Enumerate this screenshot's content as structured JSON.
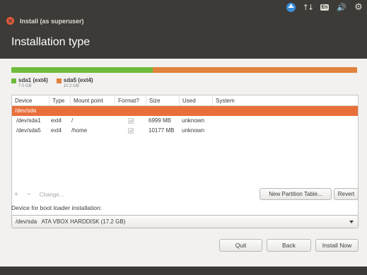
{
  "window": {
    "title": "Install (as superuser)"
  },
  "header": {
    "title": "Installation type"
  },
  "colors": {
    "sda1": "#6fba3b",
    "sda5": "#e0823b",
    "selected_row": "#e96f3a",
    "close": "#e5593a",
    "dark_panel": "#3c3b37"
  },
  "partition_bar": {
    "segments": [
      {
        "name": "sda1",
        "fraction": 0.41,
        "color": "#6fba3b"
      },
      {
        "name": "sda5",
        "fraction": 0.59,
        "color": "#e0823b"
      }
    ]
  },
  "legend": [
    {
      "name": "sda1 (ext4)",
      "size": "7.0 GB",
      "color": "#6fba3b"
    },
    {
      "name": "sda5 (ext4)",
      "size": "10.2 GB",
      "color": "#e0823b"
    }
  ],
  "table": {
    "headers": [
      "Device",
      "Type",
      "Mount point",
      "Format?",
      "Size",
      "Used",
      "System"
    ],
    "rows": [
      {
        "device": "/dev/sda",
        "type": "",
        "mount": "",
        "format": null,
        "size": "",
        "used": "",
        "system": "",
        "selected": true
      },
      {
        "device": "/dev/sda1",
        "type": "ext4",
        "mount": "/",
        "format": true,
        "size": "6999 MB",
        "used": "unknown",
        "system": ""
      },
      {
        "device": "/dev/sda5",
        "type": "ext4",
        "mount": "/home",
        "format": true,
        "size": "10177 MB",
        "used": "unknown",
        "system": ""
      }
    ]
  },
  "tools": {
    "add": "+",
    "remove": "−",
    "change": "Change..."
  },
  "buttons": {
    "new_table": "New Partition Table...",
    "revert": "Revert",
    "quit": "Quit",
    "back": "Back",
    "install": "Install Now"
  },
  "boot": {
    "label": "Device for boot loader installation:",
    "selected": "/dev/sda   ATA VBOX HARDDISK (17.2 GB)"
  },
  "tray": {
    "icons": [
      "accessibility-icon",
      "network-arrows-icon",
      "keyboard-en-icon",
      "volume-icon",
      "gear-icon"
    ],
    "keyboard": "En"
  }
}
